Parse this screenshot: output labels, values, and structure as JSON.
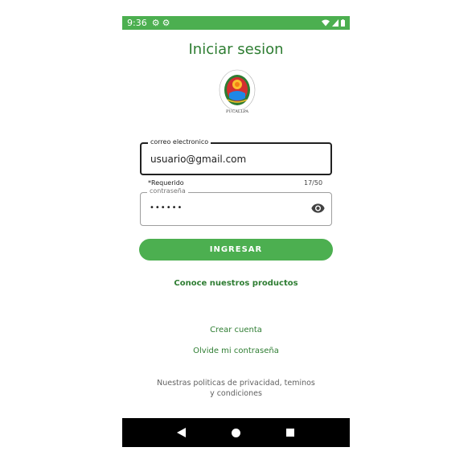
{
  "status_bar": {
    "time": "9:36"
  },
  "title": "Iniciar sesion",
  "logo": {
    "caption": "PUCALLPA"
  },
  "email_field": {
    "label": "correo electronico",
    "value": "usuario@gmail.com",
    "helper": "*Requerido",
    "counter": "17/50"
  },
  "password_field": {
    "label": "contraseña",
    "value": "••••••"
  },
  "login_button": "INGRESAR",
  "links": {
    "products": "Conoce nuestros productos",
    "create_account": "Crear cuenta",
    "forgot_password": "Olvide mi contraseña"
  },
  "policies": "Nuestras politicas de privacidad, teminos y condiciones",
  "colors": {
    "primary": "#4caf50",
    "primary_dark": "#2e7d32"
  }
}
